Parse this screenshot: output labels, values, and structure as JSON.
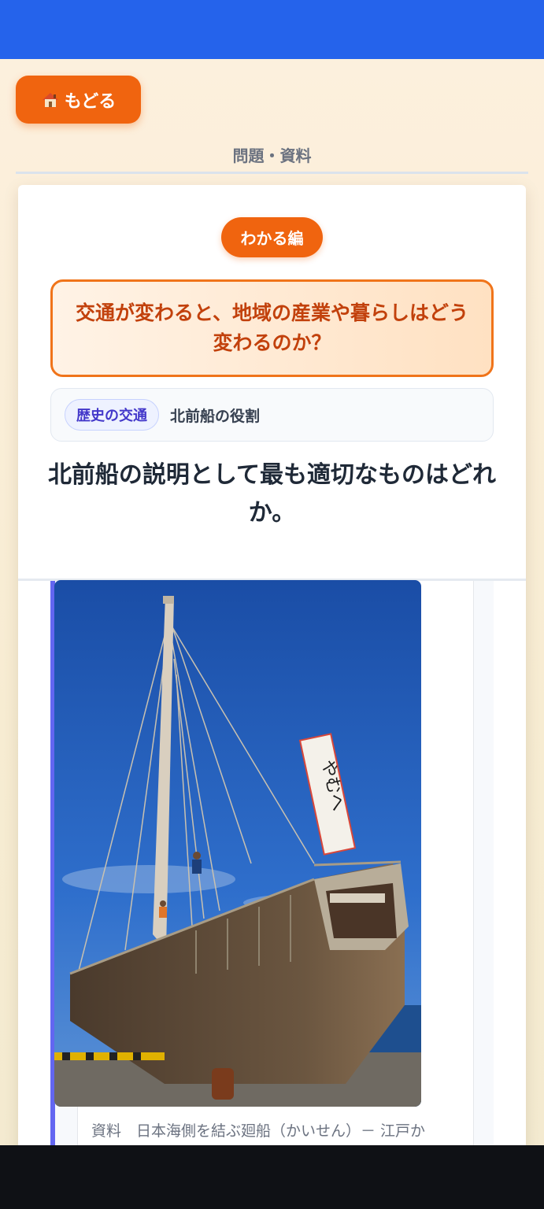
{
  "header": {
    "back_label": "もどる",
    "section_label": "問題・資料"
  },
  "card": {
    "level_badge": "わかる編",
    "theme_question": "交通が変わると、地域の産業や暮らしはどう変わるのか？",
    "category_tag": "歴史の交通",
    "topic": "北前船の役割",
    "question": "北前船の説明として最も適切なものはどれか。"
  },
  "material": {
    "caption": "資料　日本海側を結ぶ廻船（かいせん）－ 江戸か",
    "banner_text": "やむへ "
  },
  "colors": {
    "top_bar": "#2563eb",
    "accent_orange": "#f0640f",
    "tag_indigo": "#4338ca",
    "panel_border": "#6366f1"
  },
  "icons": {
    "back": "home-icon"
  }
}
